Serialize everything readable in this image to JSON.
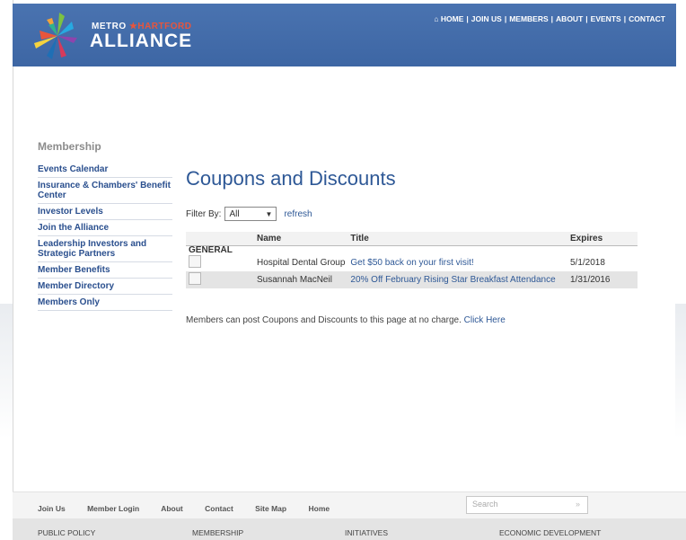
{
  "header": {
    "logo_top_left": "METRO",
    "logo_top_right": "HARTFORD",
    "logo_main": "ALLIANCE",
    "nav": [
      "HOME",
      "JOIN US",
      "MEMBERS",
      "ABOUT",
      "EVENTS",
      "CONTACT"
    ]
  },
  "sidebar": {
    "title": "Membership",
    "items": [
      {
        "label": "Events Calendar"
      },
      {
        "label": "Insurance & Chambers' Benefit Center"
      },
      {
        "label": "Investor Levels"
      },
      {
        "label": "Join the Alliance"
      },
      {
        "label": "Leadership Investors and Strategic Partners"
      },
      {
        "label": "Member Benefits"
      },
      {
        "label": "Member Directory"
      },
      {
        "label": "Members Only"
      }
    ]
  },
  "main": {
    "title": "Coupons and Discounts",
    "filter_label": "Filter By:",
    "filter_value": "All",
    "refresh_label": "refresh",
    "table": {
      "columns": [
        "Name",
        "Title",
        "Expires"
      ],
      "group": "GENERAL",
      "rows": [
        {
          "name": "Hospital Dental Group",
          "title": "Get $50 back on your first visit!",
          "expires": "5/1/2018"
        },
        {
          "name": "Susannah MacNeil",
          "title": "20% Off February Rising Star Breakfast Attendance",
          "expires": "1/31/2016"
        }
      ]
    },
    "note_text": "Members can post Coupons and Discounts to this page at no charge.",
    "note_link": "Click Here"
  },
  "footer": {
    "links": [
      "Join Us",
      "Member Login",
      "About",
      "Contact",
      "Site Map",
      "Home"
    ],
    "search_placeholder": "Search",
    "search_arrow": "»",
    "sections": [
      "PUBLIC POLICY",
      "MEMBERSHIP",
      "INITIATIVES",
      "ECONOMIC DEVELOPMENT"
    ]
  },
  "colors": {
    "header_blue": "#3d66a4",
    "link_blue": "#2e5896",
    "accent_red": "#e8553c"
  }
}
